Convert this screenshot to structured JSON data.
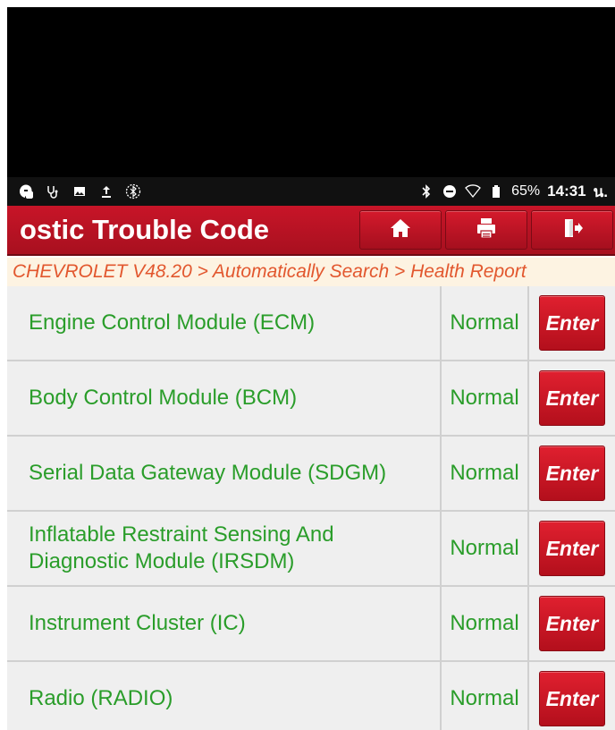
{
  "status_bar": {
    "battery": "65%",
    "time": "14:31",
    "suffix": "น."
  },
  "header": {
    "title": "ostic Trouble Code",
    "icons": [
      "home-icon",
      "print-icon",
      "exit-icon"
    ]
  },
  "breadcrumb": "CHEVROLET V48.20 > Automatically Search > Health Report",
  "rows": [
    {
      "name": "Engine Control Module (ECM)",
      "status": "Normal",
      "action": "Enter"
    },
    {
      "name": "Body Control Module (BCM)",
      "status": "Normal",
      "action": "Enter"
    },
    {
      "name": "Serial Data Gateway Module (SDGM)",
      "status": "Normal",
      "action": "Enter"
    },
    {
      "name": "Inflatable Restraint Sensing And Diagnostic Module (IRSDM)",
      "status": "Normal",
      "action": "Enter"
    },
    {
      "name": "Instrument Cluster (IC)",
      "status": "Normal",
      "action": "Enter"
    },
    {
      "name": "Radio (RADIO)",
      "status": "Normal",
      "action": "Enter"
    }
  ],
  "colors": {
    "header_red": "#c81528",
    "status_green": "#2a9d2a",
    "breadcrumb_orange": "#e2572e"
  }
}
